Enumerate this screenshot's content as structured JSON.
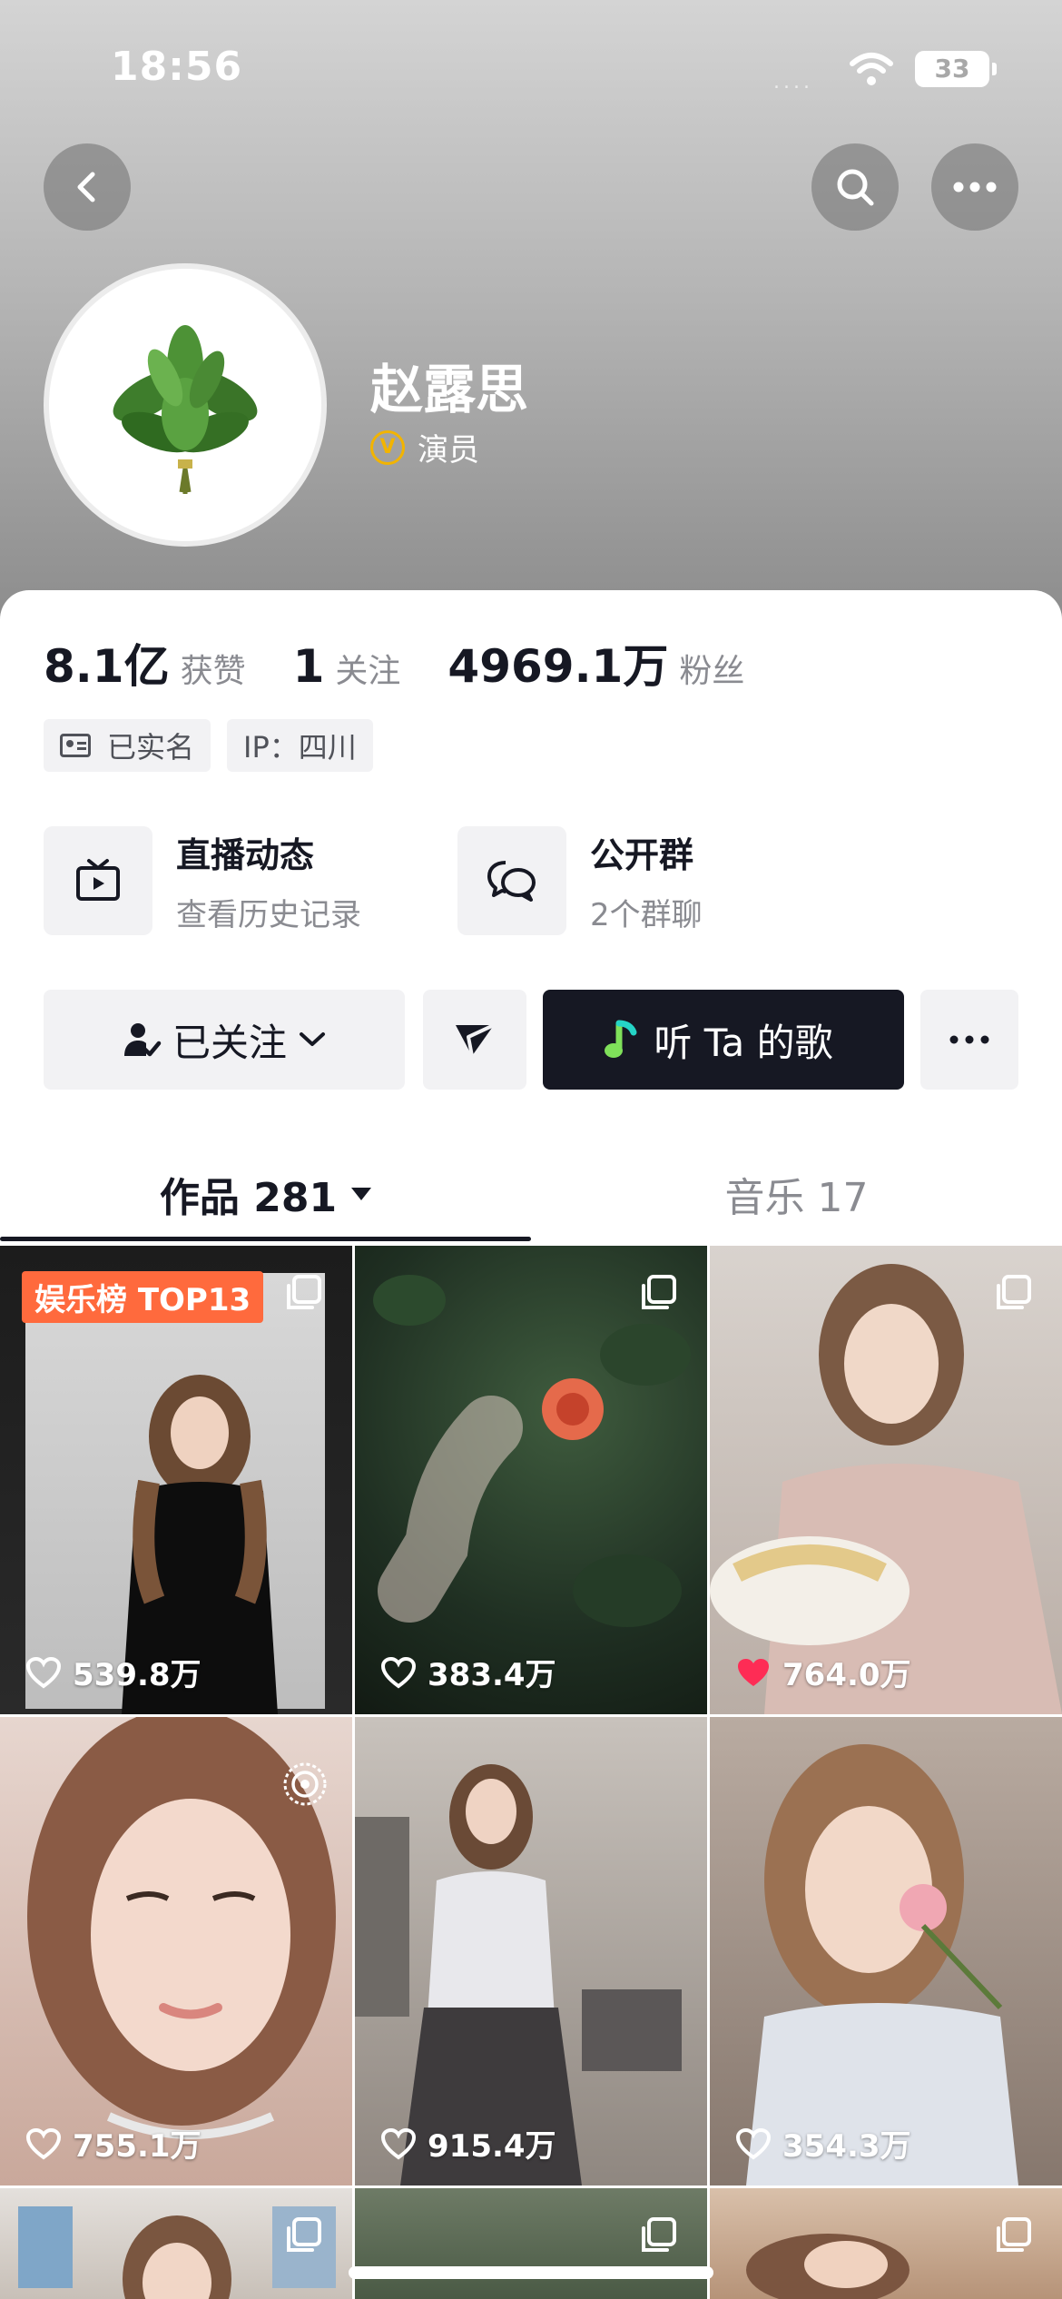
{
  "status_bar": {
    "time": "18:56",
    "signal": "....",
    "battery": "33"
  },
  "header": {
    "back_icon": "chevron-left-icon",
    "search_icon": "search-icon",
    "more_icon": "ellipsis-icon"
  },
  "profile": {
    "name": "赵露思",
    "verify_badge": "V",
    "verify_text": "演员",
    "avatar_icon": "leaf-bouquet-icon"
  },
  "stats": [
    {
      "value": "8.1亿",
      "label": "获赞"
    },
    {
      "value": "1",
      "label": "关注"
    },
    {
      "value": "4969.1万",
      "label": "粉丝"
    }
  ],
  "tags": {
    "real_name": "已实名",
    "ip": "IP：四川"
  },
  "entries": {
    "live": {
      "title": "直播动态",
      "subtitle": "查看历史记录"
    },
    "group": {
      "title": "公开群",
      "subtitle": "2个群聊"
    }
  },
  "actions": {
    "follow_label": "已关注",
    "song_label": "听 Ta 的歌"
  },
  "tabs": {
    "works": "作品 281",
    "music": "音乐 17"
  },
  "grid": [
    {
      "likes": "539.8万",
      "badge": "娱乐榜 TOP13",
      "liked": false,
      "bg": "#2c2c2c"
    },
    {
      "likes": "383.4万",
      "liked": false,
      "bg": "#2d3f30"
    },
    {
      "likes": "764.0万",
      "liked": true,
      "bg": "#bcb0a8"
    },
    {
      "likes": "755.1万",
      "liked": false,
      "bg": "#d3b6ac"
    },
    {
      "likes": "915.4万",
      "liked": false,
      "bg": "#9b938c"
    },
    {
      "likes": "354.3万",
      "liked": false,
      "bg": "#8f8076"
    }
  ],
  "colors": {
    "accent_dark": "#161823",
    "like_red": "#fe2c55",
    "badge_orange": "#ff6a3d",
    "verify_gold": "#f2b400"
  }
}
